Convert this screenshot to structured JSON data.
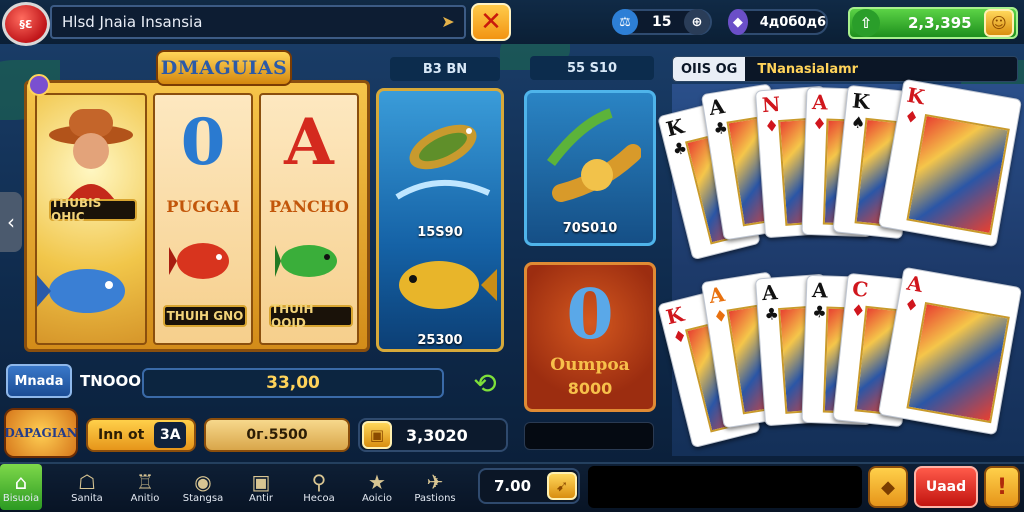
{
  "topbar": {
    "stop_label": "§Ɛ",
    "title": "Hlsd Jnaia Insansia",
    "close_glyph": "✕",
    "counter1": "15",
    "counter2": "4д0б0д6",
    "balance": "2,3,395"
  },
  "slot": {
    "logo": "DMAGUIAS",
    "reel1_label": "THUBIS OHIC",
    "reel2_letter": "0",
    "reel2_name": "PUGGAI",
    "reel2_label": "THUIH GNO",
    "reel3_letter": "A",
    "reel3_name": "PANCHO",
    "reel3_label": "THUIH OOID"
  },
  "fish_card": {
    "top_label": "B3 BN",
    "value1": "15S90",
    "value2": "25300"
  },
  "banana_card": {
    "top_label": "55 S10",
    "value": "70S010"
  },
  "orange_card": {
    "letter": "0",
    "name": "Oumpoa",
    "value": "8000"
  },
  "cards_panel": {
    "tag": "OIIS OG",
    "title": "TNanasialamr",
    "top_row": [
      {
        "rank": "K",
        "suit": "♣",
        "color": "#111111"
      },
      {
        "rank": "A",
        "suit": "♣",
        "color": "#111111"
      },
      {
        "rank": "N",
        "suit": "♦",
        "color": "#d0161d"
      },
      {
        "rank": "A",
        "suit": "♦",
        "color": "#d0161d"
      },
      {
        "rank": "K",
        "suit": "♠",
        "color": "#111111"
      },
      {
        "rank": "K",
        "suit": "♦",
        "color": "#d0161d"
      }
    ],
    "bottom_row": [
      {
        "rank": "K",
        "suit": "♦",
        "color": "#d0161d"
      },
      {
        "rank": "A",
        "suit": "♦",
        "color": "#e8710f"
      },
      {
        "rank": "A",
        "suit": "♣",
        "color": "#111111"
      },
      {
        "rank": "A",
        "suit": "♣",
        "color": "#111111"
      },
      {
        "rank": "C",
        "suit": "♦",
        "color": "#d0161d"
      },
      {
        "rank": "A",
        "suit": "♦",
        "color": "#d0161d"
      }
    ]
  },
  "controls": {
    "menu_label": "Mnada",
    "tnoo_label": "TNOOO",
    "progress_value": "33,00",
    "inn_label": "Inn ot",
    "inn_value": "3A",
    "bet_value": "0г.5500",
    "credit_value": "3,3020",
    "game_logo": "DAPAGIAN"
  },
  "bottom_nav": {
    "items": [
      {
        "label": "Bisuoia",
        "icon": "⌂"
      },
      {
        "label": "Sanita",
        "icon": "☖"
      },
      {
        "label": "Anitio",
        "icon": "♖"
      },
      {
        "label": "Stangsa",
        "icon": "◉"
      },
      {
        "label": "Antir",
        "icon": "▣"
      },
      {
        "label": "Hecoa",
        "icon": "⚲"
      },
      {
        "label": "Aoicio",
        "icon": "★"
      },
      {
        "label": "Pastions",
        "icon": "✈"
      }
    ],
    "speed_value": "7.00",
    "red_button": "Uaad"
  }
}
